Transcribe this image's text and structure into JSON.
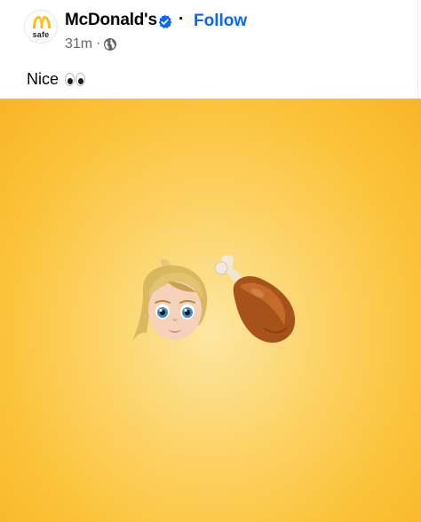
{
  "post": {
    "author": "McDonald's",
    "avatar_text": "safe",
    "verified": true,
    "separator": "·",
    "follow_label": "Follow",
    "time": "31m",
    "time_separator": "·",
    "privacy_icon": "globe-icon",
    "text": "Nice",
    "text_emoji": "eyes-emoji"
  },
  "image": {
    "emojis": [
      "woman-blond-hair-emoji",
      "poultry-leg-emoji"
    ],
    "background_colors": [
      "#fde7a3",
      "#fbc33a",
      "#f8b428"
    ]
  },
  "colors": {
    "accent": "#0866ff",
    "text": "#050505",
    "meta": "#65676b",
    "verified": "#0866ff",
    "brand_yellow": "#ffbc0d"
  }
}
